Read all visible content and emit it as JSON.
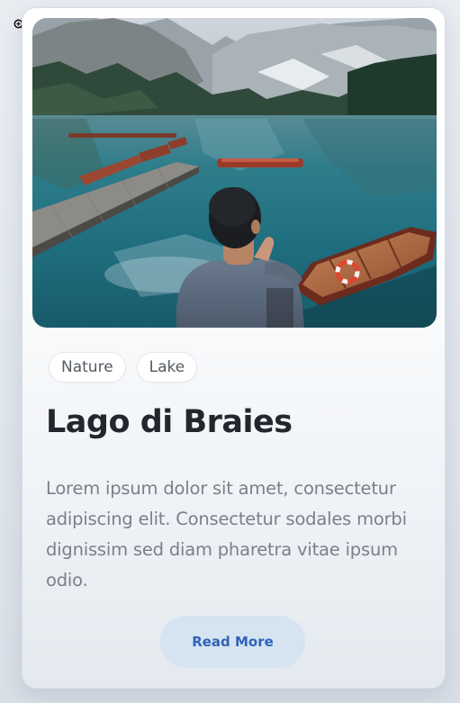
{
  "card": {
    "image": {
      "alt": "Man sitting on a dock overlooking a turquoise mountain lake with wooden rowboats"
    },
    "tags": [
      "Nature",
      "Lake"
    ],
    "title": "Lago di Braies",
    "description": "Lorem ipsum dolor sit amet, consectetur adipiscing elit. Consectetur sodales morbi dignissim sed diam pharetra vitae ipsum odio.",
    "button_label": "Read More"
  },
  "colors": {
    "button_bg": "#d6e3f1",
    "button_text": "#2e64b7",
    "title": "#23272d",
    "description": "#7b8089"
  },
  "icons": {
    "cursor": "zoom-in-icon"
  }
}
